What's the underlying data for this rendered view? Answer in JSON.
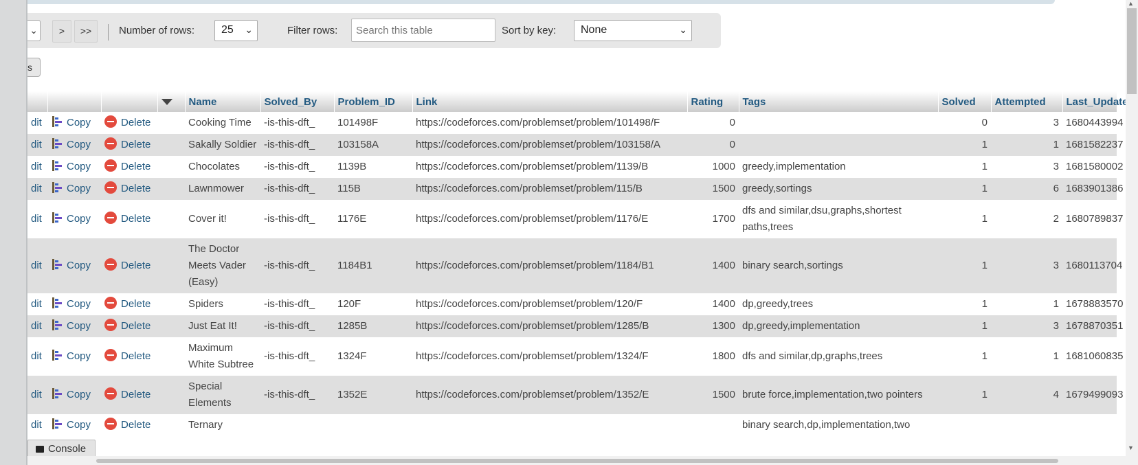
{
  "nav": {
    "page_select_chev": "⌄",
    "next_label": ">",
    "last_label": ">>",
    "rows_label": "Number of rows:",
    "rows_value": "25",
    "filter_label": "Filter rows:",
    "filter_placeholder": "Search this table",
    "sort_label": "Sort by key:",
    "sort_value": "None",
    "small_button_label": "s"
  },
  "actions": {
    "edit": "dit",
    "copy": "Copy",
    "delete": "Delete"
  },
  "table": {
    "columns": [
      "Name",
      "Solved_By",
      "Problem_ID",
      "Link",
      "Rating",
      "Tags",
      "Solved",
      "Attempted",
      "Last_Update"
    ],
    "rows": [
      {
        "name": "Cooking Time",
        "solved_by": "-is-this-dft_",
        "problem_id": "101498F",
        "link": "https://codeforces.com/problemset/problem/101498/F",
        "rating": "0",
        "tags": "",
        "solved": "0",
        "attempted": "3",
        "last_update": "1680443994"
      },
      {
        "name": "Sakally Soldier",
        "solved_by": "-is-this-dft_",
        "problem_id": "103158A",
        "link": "https://codeforces.com/problemset/problem/103158/A",
        "rating": "0",
        "tags": "",
        "solved": "1",
        "attempted": "1",
        "last_update": "1681582237"
      },
      {
        "name": "Chocolates",
        "solved_by": "-is-this-dft_",
        "problem_id": "1139B",
        "link": "https://codeforces.com/problemset/problem/1139/B",
        "rating": "1000",
        "tags": "greedy,implementation",
        "solved": "1",
        "attempted": "3",
        "last_update": "1681580002"
      },
      {
        "name": "Lawnmower",
        "solved_by": "-is-this-dft_",
        "problem_id": "115B",
        "link": "https://codeforces.com/problemset/problem/115/B",
        "rating": "1500",
        "tags": "greedy,sortings",
        "solved": "1",
        "attempted": "6",
        "last_update": "1683901386"
      },
      {
        "name": "Cover it!",
        "solved_by": "-is-this-dft_",
        "problem_id": "1176E",
        "link": "https://codeforces.com/problemset/problem/1176/E",
        "rating": "1700",
        "tags": "dfs and similar,dsu,graphs,shortest paths,trees",
        "solved": "1",
        "attempted": "2",
        "last_update": "1680789837"
      },
      {
        "name": "The Doctor Meets Vader (Easy)",
        "solved_by": "-is-this-dft_",
        "problem_id": "1184B1",
        "link": "https://codeforces.com/problemset/problem/1184/B1",
        "rating": "1400",
        "tags": "binary search,sortings",
        "solved": "1",
        "attempted": "3",
        "last_update": "1680113704"
      },
      {
        "name": "Spiders",
        "solved_by": "-is-this-dft_",
        "problem_id": "120F",
        "link": "https://codeforces.com/problemset/problem/120/F",
        "rating": "1400",
        "tags": "dp,greedy,trees",
        "solved": "1",
        "attempted": "1",
        "last_update": "1678883570"
      },
      {
        "name": "Just Eat It!",
        "solved_by": "-is-this-dft_",
        "problem_id": "1285B",
        "link": "https://codeforces.com/problemset/problem/1285/B",
        "rating": "1300",
        "tags": "dp,greedy,implementation",
        "solved": "1",
        "attempted": "3",
        "last_update": "1678870351"
      },
      {
        "name": "Maximum White Subtree",
        "solved_by": "-is-this-dft_",
        "problem_id": "1324F",
        "link": "https://codeforces.com/problemset/problem/1324/F",
        "rating": "1800",
        "tags": "dfs and similar,dp,graphs,trees",
        "solved": "1",
        "attempted": "1",
        "last_update": "1681060835"
      },
      {
        "name": "Special Elements",
        "solved_by": "-is-this-dft_",
        "problem_id": "1352E",
        "link": "https://codeforces.com/problemset/problem/1352/E",
        "rating": "1500",
        "tags": "brute force,implementation,two pointers",
        "solved": "1",
        "attempted": "4",
        "last_update": "1679499093"
      },
      {
        "name": "Ternary",
        "solved_by": "",
        "problem_id": "",
        "link": "",
        "rating": "",
        "tags": "binary search,dp,implementation,two",
        "solved": "",
        "attempted": "",
        "last_update": ""
      }
    ]
  },
  "console": {
    "label": "Console"
  }
}
